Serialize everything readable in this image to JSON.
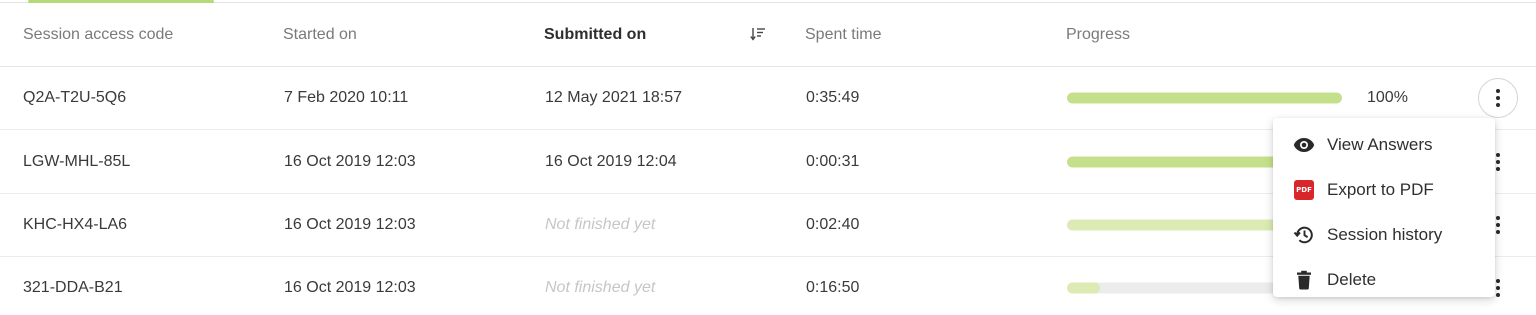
{
  "table": {
    "headers": {
      "code": "Session access code",
      "started": "Started on",
      "submitted": "Submitted on",
      "spent": "Spent time",
      "progress": "Progress"
    },
    "sort_icon": "sort-descending-icon",
    "rows": [
      {
        "code": "Q2A-T2U-5Q6",
        "started": "7 Feb 2020 10:11",
        "submitted": "12 May 2021 18:57",
        "spent": "0:35:49",
        "progress": 1.0,
        "progress_label": "100%"
      },
      {
        "code": "LGW-MHL-85L",
        "started": "16 Oct 2019 12:03",
        "submitted": "16 Oct 2019 12:04",
        "spent": "0:00:31",
        "progress": 1.0
      },
      {
        "code": "KHC-HX4-LA6",
        "started": "16 Oct 2019 12:03",
        "submitted": "Not finished yet",
        "spent": "0:02:40",
        "progress": 1.0
      },
      {
        "code": "321-DDA-B21",
        "started": "16 Oct 2019 12:03",
        "submitted": "Not finished yet",
        "spent": "0:16:50",
        "progress": 0.12
      }
    ]
  },
  "context_menu": {
    "items": [
      {
        "label": "View Answers",
        "icon": "eye-icon"
      },
      {
        "label": "Export to PDF",
        "icon": "pdf-icon",
        "badge_text": "PDF"
      },
      {
        "label": "Session history",
        "icon": "history-icon"
      },
      {
        "label": "Delete",
        "icon": "trash-icon"
      }
    ]
  },
  "colors": {
    "accent": "#b7d97a",
    "progress_fill": "#c5e08a",
    "progress_fill_incomplete": "#dcebb3",
    "pdf_red": "#d8262a"
  }
}
